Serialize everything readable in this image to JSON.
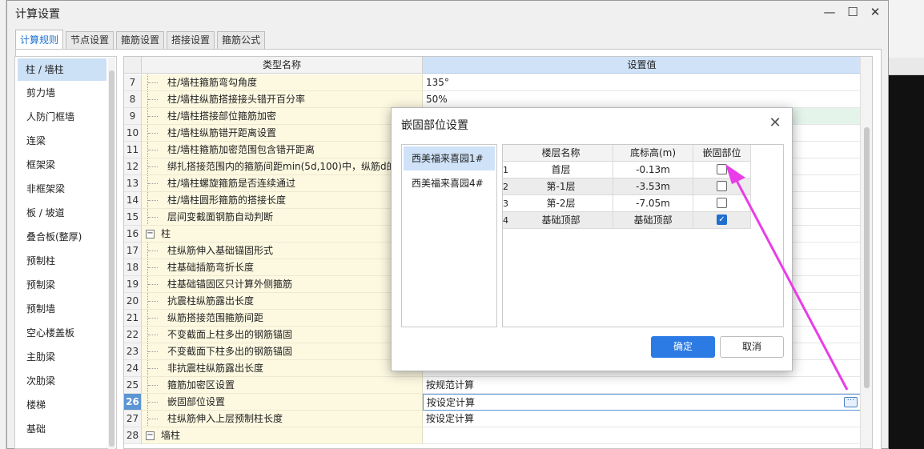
{
  "window": {
    "title": "计算设置",
    "controls": {
      "minimize": "—",
      "maximize": "☐",
      "close": "✕"
    }
  },
  "tabs": [
    "计算规则",
    "节点设置",
    "箍筋设置",
    "搭接设置",
    "箍筋公式"
  ],
  "nav": {
    "items": [
      "柱 / 墙柱",
      "剪力墙",
      "人防门框墙",
      "连梁",
      "框架梁",
      "非框架梁",
      "板 / 坡道",
      "叠合板(整厚)",
      "预制柱",
      "预制梁",
      "预制墙",
      "空心楼盖板",
      "主肋梁",
      "次肋梁",
      "楼梯",
      "基础"
    ]
  },
  "grid": {
    "headers": {
      "name": "类型名称",
      "value": "设置值"
    },
    "rows": [
      {
        "num": "7",
        "name": "柱/墙柱箍筋弯勾角度",
        "value": "135°"
      },
      {
        "num": "8",
        "name": "柱/墙柱纵筋搭接接头错开百分率",
        "value": "50%"
      },
      {
        "num": "9",
        "name": "柱/墙柱搭接部位箍筋加密",
        "value": ""
      },
      {
        "num": "10",
        "name": "柱/墙柱纵筋错开距离设置",
        "value": ""
      },
      {
        "num": "11",
        "name": "柱/墙柱箍筋加密范围包含错开距离",
        "value": ""
      },
      {
        "num": "12",
        "name": "绑扎搭接范围内的箍筋间距min(5d,100)中，纵筋d的",
        "value": ""
      },
      {
        "num": "13",
        "name": "柱/墙柱螺旋箍筋是否连续通过",
        "value": ""
      },
      {
        "num": "14",
        "name": "柱/墙柱圆形箍筋的搭接长度",
        "value": ""
      },
      {
        "num": "15",
        "name": "层间变截面钢筋自动判断",
        "value": ""
      },
      {
        "num": "16",
        "name": "柱",
        "value": "",
        "group": true,
        "expander": "−"
      },
      {
        "num": "17",
        "name": "柱纵筋伸入基础锚固形式",
        "value": ""
      },
      {
        "num": "18",
        "name": "柱基础插筋弯折长度",
        "value": ""
      },
      {
        "num": "19",
        "name": "柱基础锚固区只计算外侧箍筋",
        "value": ""
      },
      {
        "num": "20",
        "name": "抗震柱纵筋露出长度",
        "value": ""
      },
      {
        "num": "21",
        "name": "纵筋搭接范围箍筋间距",
        "value": ""
      },
      {
        "num": "22",
        "name": "不变截面上柱多出的钢筋锚固",
        "value": ""
      },
      {
        "num": "23",
        "name": "不变截面下柱多出的钢筋锚固",
        "value": ""
      },
      {
        "num": "24",
        "name": "非抗震柱纵筋露出长度",
        "value": ""
      },
      {
        "num": "25",
        "name": "箍筋加密区设置",
        "value": "按规范计算"
      },
      {
        "num": "26",
        "name": "嵌固部位设置",
        "value": "按设定计算",
        "selected": true,
        "more": "···"
      },
      {
        "num": "27",
        "name": "柱纵筋伸入上层预制柱长度",
        "value": "按设定计算"
      },
      {
        "num": "28",
        "name": "墙柱",
        "value": "",
        "group": true,
        "expander": "−"
      }
    ]
  },
  "modal": {
    "title": "嵌固部位设置",
    "close": "✕",
    "projects": [
      "西美福来喜园1#",
      "西美福来喜园4#"
    ],
    "table": {
      "headers": {
        "name": "楼层名称",
        "elev": "底标高(m)",
        "embed": "嵌固部位"
      },
      "rows": [
        {
          "idx": "1",
          "name": "首层",
          "elev": "-0.13m",
          "checked": false
        },
        {
          "idx": "2",
          "name": "第-1层",
          "elev": "-3.53m",
          "checked": false
        },
        {
          "idx": "3",
          "name": "第-2层",
          "elev": "-7.05m",
          "checked": false
        },
        {
          "idx": "4",
          "name": "基础顶部",
          "elev": "基础顶部",
          "checked": true
        }
      ]
    },
    "ok_label": "确定",
    "cancel_label": "取消"
  },
  "colors": {
    "accent": "#2c7be5",
    "annotation": "#e83de8"
  }
}
